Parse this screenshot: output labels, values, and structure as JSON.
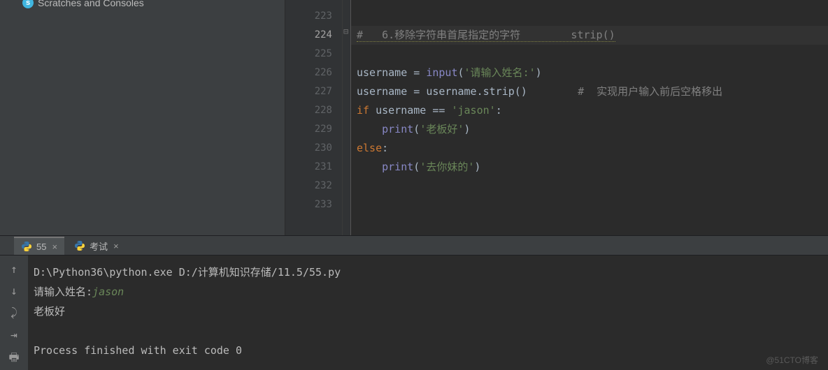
{
  "sidebar": {
    "scratches_label": "Scratches and Consoles"
  },
  "gutter": {
    "fold_label": "Collapse block"
  },
  "code": {
    "lines": [
      "223",
      "224",
      "225",
      "226",
      "227",
      "228",
      "229",
      "230",
      "231",
      "232",
      "233"
    ],
    "l224_comment": "#   6.移除字符串首尾指定的字符        strip()",
    "l226_a": "username = ",
    "l226_fn": "input",
    "l226_b": "(",
    "l226_str": "'请输入姓名:'",
    "l226_c": ")",
    "l227_a": "username = username.strip()",
    "l227_cm": "#  实现用户输入前后空格移出",
    "l228_if": "if",
    "l228_a": " username == ",
    "l228_str": "'jason'",
    "l228_b": ":",
    "l229_fn": "print",
    "l229_a": "(",
    "l229_str": "'老板好'",
    "l229_b": ")",
    "l230_else": "else",
    "l230_a": ":",
    "l231_fn": "print",
    "l231_a": "(",
    "l231_str": "'去你妹的'",
    "l231_b": ")"
  },
  "tabs": {
    "t1": "55",
    "t2": "考试"
  },
  "console": {
    "cmd": "D:\\Python36\\python.exe D:/计算机知识存储/11.5/55.py",
    "prompt": "请输入姓名:",
    "user_input": "jason",
    "out1": "老板好",
    "exit": "Process finished with exit code 0"
  },
  "toolbar": {
    "up": "Scroll up",
    "down": "Scroll down",
    "wrap": "Soft wrap",
    "scroll_end": "Scroll to end",
    "print": "Print"
  },
  "watermark": "@51CTO博客"
}
